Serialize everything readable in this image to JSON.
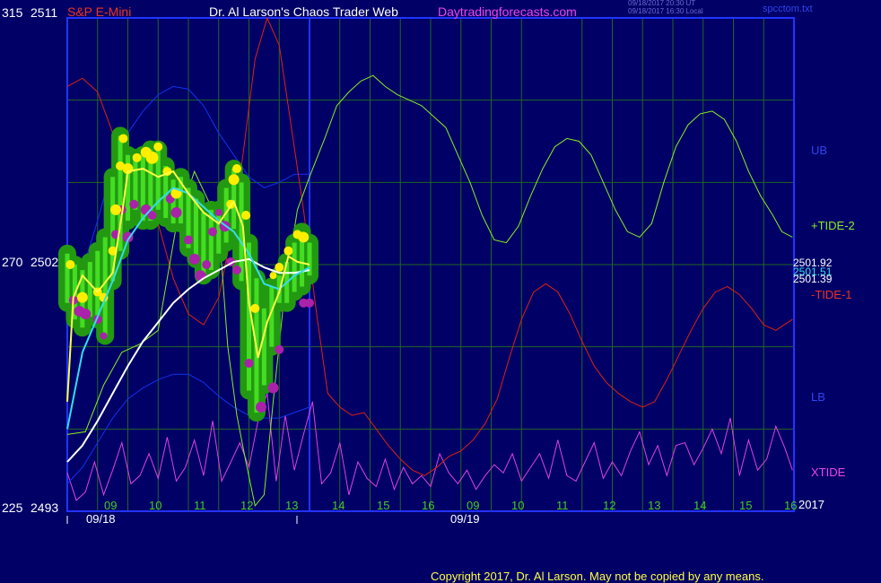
{
  "header": {
    "symbol": "S&P E-Mini",
    "title": "Dr. Al Larson's Chaos Trader Web",
    "site": "Daytradingforecasts.com",
    "timestamp_1": "09/18/2017 20:30 UT",
    "timestamp_2": "09/18/2017 16:30 Local",
    "file": "spcctom.txt"
  },
  "y_axis": {
    "top_left": "315",
    "top_right": "2511",
    "mid_left": "270",
    "mid_right": "2502",
    "bottom_left": "225",
    "bottom_right": "2493"
  },
  "x_axis": {
    "day1_ticks": [
      "09",
      "10",
      "11",
      "12",
      "13",
      "14",
      "15",
      "16"
    ],
    "day2_ticks": [
      "09",
      "10",
      "11",
      "12",
      "13",
      "14",
      "15",
      "16"
    ],
    "date1": "09/18",
    "date2": "09/19",
    "year": "2017"
  },
  "right_labels": {
    "ub": "UB",
    "tide2": "+TIDE-2",
    "price1": "2501.92",
    "price2": "2501.51",
    "price3": "2501.39",
    "tide1": "-TIDE-1",
    "lb": "LB",
    "xtide": "XTIDE"
  },
  "copyright": "Copyright 2017, Dr. Al Larson. May not be copied by any means.",
  "colors": {
    "background": "#000066",
    "frame": "#2233ff",
    "grid": "#226622",
    "price_bars": "#44dd22",
    "price_glow": "#229911",
    "yellow_line": "#ffff44",
    "cyan_line": "#33ddee",
    "white_line": "#ffffff",
    "tide2": "#88ee22",
    "tide1": "#dd2211",
    "bands": "#1133ee",
    "xtide": "#dd44dd",
    "dots_yellow": "#ffee00",
    "dots_magenta": "#aa22aa"
  },
  "chart_data": {
    "type": "line",
    "x_unit": "hour of session (day 1 = 09/18, hours 25+ = 09/19 forecast)",
    "ylim_price": [
      2493,
      2511
    ],
    "ylim_scale": [
      225,
      315
    ],
    "x_range": [
      8.0,
      32.0
    ],
    "grid": true,
    "series": [
      {
        "name": "+TIDE-2",
        "x": [
          8.0,
          8.6,
          9.2,
          9.8,
          10.4,
          11.0,
          11.6,
          12.2,
          12.8,
          13.1,
          13.3,
          13.6,
          13.9,
          14.2,
          14.5,
          14.8,
          15.2,
          15.6,
          16.0,
          16.5,
          16.9,
          17.3,
          17.7,
          18.1,
          18.5,
          18.9,
          19.3,
          19.7,
          20.1,
          20.5,
          20.9,
          21.3,
          21.7,
          22.1,
          22.5,
          22.9,
          23.3,
          23.7,
          24.1,
          24.5,
          24.9,
          25.3,
          25.7,
          26.1,
          26.5,
          26.9,
          27.3,
          27.7,
          28.1,
          28.5,
          28.9,
          29.3,
          29.7,
          30.1,
          30.5,
          30.9,
          31.3,
          31.6,
          31.95
        ],
        "y": [
          2495.8,
          2495.9,
          2497.6,
          2498.8,
          2499.1,
          2499.6,
          2503.4,
          2505.4,
          2504.0,
          2502.0,
          2499.0,
          2496.5,
          2494.8,
          2493.2,
          2493.6,
          2497.0,
          2501.2,
          2504.0,
          2505.2,
          2506.6,
          2507.8,
          2508.3,
          2508.7,
          2508.9,
          2508.5,
          2508.2,
          2508.0,
          2507.8,
          2507.4,
          2507.0,
          2506.0,
          2505.0,
          2503.8,
          2502.9,
          2502.8,
          2503.4,
          2504.5,
          2505.5,
          2506.3,
          2506.6,
          2506.5,
          2506.0,
          2505.0,
          2504.0,
          2503.2,
          2503.0,
          2503.5,
          2505.0,
          2506.3,
          2507.1,
          2507.5,
          2507.6,
          2507.3,
          2506.5,
          2505.4,
          2504.5,
          2503.8,
          2503.2,
          2503.0
        ]
      },
      {
        "name": "-TIDE-1",
        "x": [
          8.0,
          8.5,
          9.0,
          9.5,
          10.0,
          10.5,
          11.0,
          11.5,
          12.0,
          12.5,
          13.0,
          13.4,
          13.8,
          14.2,
          14.6,
          15.0,
          15.4,
          15.8,
          16.2,
          16.6,
          17.0,
          17.4,
          17.8,
          18.2,
          18.6,
          19.0,
          19.4,
          19.8,
          20.2,
          20.6,
          21.0,
          21.4,
          21.8,
          22.2,
          22.6,
          23.0,
          23.4,
          23.8,
          24.2,
          24.6,
          25.0,
          25.4,
          25.8,
          26.2,
          26.6,
          27.0,
          27.4,
          27.8,
          28.2,
          28.6,
          29.0,
          29.4,
          29.8,
          30.2,
          30.6,
          31.0,
          31.4,
          31.95
        ],
        "y": [
          2508.5,
          2508.8,
          2508.3,
          2506.8,
          2506.0,
          2505.2,
          2503.5,
          2501.5,
          2500.2,
          2499.8,
          2500.8,
          2503.0,
          2506.0,
          2509.5,
          2511.0,
          2510.0,
          2507.0,
          2504.0,
          2500.5,
          2497.3,
          2496.8,
          2496.5,
          2496.6,
          2496.0,
          2495.4,
          2494.9,
          2494.5,
          2494.3,
          2494.6,
          2495.0,
          2495.2,
          2495.6,
          2496.2,
          2497.1,
          2498.6,
          2500.0,
          2501.0,
          2501.3,
          2501.0,
          2500.2,
          2499.2,
          2498.3,
          2497.7,
          2497.3,
          2497.0,
          2496.8,
          2497.0,
          2497.8,
          2498.7,
          2499.6,
          2500.4,
          2501.0,
          2501.2,
          2500.9,
          2500.4,
          2499.8,
          2499.6,
          2500.0
        ]
      },
      {
        "name": "UB",
        "x": [
          8.0,
          8.5,
          9.0,
          9.5,
          10.0,
          10.5,
          11.0,
          11.5,
          12.0,
          12.5,
          13.0,
          13.5,
          14.0,
          14.5,
          15.0,
          15.5,
          16.0
        ],
        "y": [
          2500.5,
          2501.8,
          2503.6,
          2505.6,
          2506.8,
          2507.6,
          2508.2,
          2508.5,
          2508.4,
          2507.8,
          2506.8,
          2506.0,
          2505.2,
          2504.8,
          2505.0,
          2505.3,
          2505.3
        ]
      },
      {
        "name": "LB",
        "x": [
          8.0,
          8.5,
          9.0,
          9.5,
          10.0,
          10.5,
          11.0,
          11.5,
          12.0,
          12.5,
          13.0,
          13.5,
          14.0,
          14.5,
          15.0,
          15.5,
          16.0
        ],
        "y": [
          2494.0,
          2494.6,
          2495.5,
          2496.4,
          2497.1,
          2497.5,
          2497.8,
          2498.0,
          2498.0,
          2497.7,
          2497.2,
          2496.8,
          2496.5,
          2496.4,
          2496.4,
          2496.6,
          2496.8
        ]
      },
      {
        "name": "yellow_ma",
        "x": [
          8.0,
          8.2,
          8.5,
          9.0,
          9.5,
          9.8,
          10.0,
          10.5,
          11.0,
          11.5,
          12.0,
          12.5,
          13.0,
          13.5,
          13.8,
          14.0,
          14.3,
          14.6,
          15.0,
          15.3,
          15.6,
          16.0
        ],
        "y": [
          2497.0,
          2500.8,
          2501.6,
          2501.0,
          2501.7,
          2503.8,
          2505.4,
          2505.5,
          2505.2,
          2505.4,
          2504.6,
          2503.9,
          2503.5,
          2504.3,
          2503.4,
          2500.6,
          2498.6,
          2499.9,
          2501.0,
          2502.3,
          2502.1,
          2502.0
        ]
      },
      {
        "name": "cyan_ma",
        "x": [
          8.0,
          8.5,
          9.0,
          9.5,
          10.0,
          10.5,
          11.0,
          11.5,
          12.0,
          12.5,
          13.0,
          13.5,
          14.0,
          14.5,
          15.0,
          15.5,
          16.0
        ],
        "y": [
          2496.0,
          2498.8,
          2500.1,
          2501.4,
          2502.9,
          2503.7,
          2504.3,
          2504.8,
          2504.6,
          2504.1,
          2503.6,
          2503.2,
          2502.4,
          2501.3,
          2501.1,
          2501.6,
          2501.9
        ]
      },
      {
        "name": "white_ma",
        "x": [
          8.0,
          8.5,
          9.0,
          9.5,
          10.0,
          10.5,
          11.0,
          11.5,
          12.0,
          12.5,
          13.0,
          13.5,
          14.0,
          14.5,
          15.0,
          15.5,
          16.0
        ],
        "y": [
          2494.8,
          2495.4,
          2496.3,
          2497.3,
          2498.3,
          2499.2,
          2499.9,
          2500.6,
          2501.1,
          2501.5,
          2501.8,
          2502.1,
          2502.2,
          2501.9,
          2501.7,
          2501.7,
          2501.8
        ]
      },
      {
        "name": "XTIDE",
        "x": [
          8.0,
          8.3,
          8.6,
          8.9,
          9.2,
          9.5,
          9.8,
          10.1,
          10.4,
          10.7,
          11.0,
          11.3,
          11.6,
          11.9,
          12.2,
          12.5,
          12.8,
          13.1,
          13.4,
          13.7,
          14.0,
          14.3,
          14.6,
          14.9,
          15.2,
          15.5,
          15.8,
          16.1,
          16.4,
          16.7,
          17.0,
          17.3,
          17.6,
          17.9,
          18.2,
          18.5,
          18.8,
          19.1,
          19.4,
          19.7,
          20.0,
          20.3,
          20.6,
          20.9,
          21.2,
          21.5,
          21.8,
          22.1,
          22.4,
          22.7,
          23.0,
          23.3,
          23.6,
          23.9,
          24.2,
          24.5,
          24.8,
          25.1,
          25.4,
          25.7,
          26.0,
          26.3,
          26.6,
          26.9,
          27.2,
          27.5,
          27.8,
          28.1,
          28.4,
          28.7,
          29.0,
          29.3,
          29.6,
          29.9,
          30.2,
          30.5,
          30.8,
          31.1,
          31.4,
          31.7,
          31.95
        ],
        "y": [
          2494.4,
          2493.4,
          2493.7,
          2494.8,
          2493.6,
          2494.5,
          2495.5,
          2494.0,
          2494.3,
          2495.1,
          2494.2,
          2495.7,
          2494.1,
          2494.6,
          2495.6,
          2494.3,
          2496.3,
          2494.1,
          2494.8,
          2495.5,
          2494.6,
          2496.3,
          2497.3,
          2494.1,
          2496.5,
          2494.5,
          2495.8,
          2497.0,
          2494.0,
          2494.4,
          2495.5,
          2493.6,
          2494.8,
          2494.2,
          2493.9,
          2494.9,
          2493.8,
          2494.6,
          2494.0,
          2494.3,
          2493.9,
          2495.1,
          2494.4,
          2494.0,
          2494.5,
          2493.8,
          2494.3,
          2494.7,
          2494.4,
          2495.1,
          2494.1,
          2494.6,
          2495.1,
          2494.2,
          2495.6,
          2494.3,
          2494.1,
          2494.8,
          2495.5,
          2494.2,
          2494.8,
          2494.3,
          2495.2,
          2495.9,
          2494.7,
          2495.4,
          2494.3,
          2495.4,
          2495.5,
          2494.7,
          2495.3,
          2496.0,
          2495.1,
          2496.4,
          2494.3,
          2495.6,
          2494.5,
          2494.9,
          2496.1,
          2495.3,
          2494.5
        ]
      }
    ],
    "price_bars": {
      "x": [
        8.0,
        8.25,
        8.5,
        8.75,
        9.0,
        9.25,
        9.5,
        9.75,
        10.0,
        10.25,
        10.5,
        10.75,
        11.0,
        11.25,
        11.5,
        11.75,
        12.0,
        12.25,
        12.5,
        12.75,
        13.0,
        13.25,
        13.5,
        13.75,
        14.0,
        14.25,
        14.5,
        14.75,
        15.0,
        15.25,
        15.5,
        15.75,
        16.0
      ],
      "high": [
        2502.4,
        2502.0,
        2501.8,
        2502.1,
        2502.5,
        2503.0,
        2505.2,
        2506.7,
        2506.0,
        2505.9,
        2506.0,
        2506.2,
        2506.2,
        2505.6,
        2505.1,
        2505.2,
        2504.8,
        2504.4,
        2503.9,
        2504.0,
        2504.0,
        2504.8,
        2505.5,
        2505.0,
        2502.8,
        2501.5,
        2500.4,
        2501.2,
        2501.6,
        2502.1,
        2502.8,
        2503.2,
        2502.8
      ],
      "low": [
        2500.6,
        2500.0,
        2499.7,
        2500.1,
        2500.0,
        2499.4,
        2501.4,
        2502.5,
        2503.6,
        2504.0,
        2503.6,
        2503.6,
        2504.0,
        2503.7,
        2503.5,
        2503.5,
        2502.6,
        2502.2,
        2501.6,
        2501.8,
        2502.4,
        2502.8,
        2503.3,
        2501.4,
        2497.4,
        2496.6,
        2497.6,
        2499.0,
        2500.6,
        2500.6,
        2501.0,
        2501.2,
        2501.6
      ]
    },
    "yellow_dots": {
      "x": [
        8.1,
        8.5,
        9.0,
        9.2,
        9.5,
        9.6,
        9.75,
        9.85,
        10.0,
        10.3,
        10.6,
        10.8,
        11.0,
        11.3,
        11.6,
        13.4,
        13.5,
        13.6,
        13.9,
        14.2,
        14.8,
        15.0,
        15.3,
        15.6,
        15.8
      ],
      "y": [
        2502.0,
        2500.8,
        2501.0,
        2500.8,
        2502.5,
        2504.0,
        2505.6,
        2506.6,
        2505.5,
        2505.9,
        2506.1,
        2505.9,
        2506.3,
        2505.4,
        2504.6,
        2504.2,
        2505.1,
        2505.5,
        2503.8,
        2500.4,
        2501.6,
        2501.9,
        2502.5,
        2503.1,
        2503.0
      ],
      "r": [
        5,
        6,
        5,
        5,
        5,
        6,
        5,
        5,
        6,
        5,
        6,
        7,
        5,
        5,
        6,
        5,
        6,
        5,
        5,
        5,
        4,
        5,
        5,
        5,
        6
      ]
    },
    "magenta_dots": {
      "x": [
        8.2,
        8.4,
        8.6,
        9.0,
        9.2,
        9.6,
        9.8,
        10.0,
        10.2,
        10.6,
        10.8,
        11.4,
        11.6,
        12.0,
        12.2,
        12.4,
        12.6,
        12.8,
        13.0,
        13.2,
        13.4,
        13.6,
        14.0,
        14.4,
        14.8,
        15.0,
        15.8,
        16.0
      ],
      "y": [
        2500.7,
        2500.3,
        2500.2,
        2500.0,
        2499.4,
        2503.1,
        2504.0,
        2503.0,
        2504.2,
        2504.0,
        2503.8,
        2504.4,
        2503.9,
        2502.9,
        2502.2,
        2501.6,
        2502.0,
        2503.2,
        2503.9,
        2503.4,
        2502.1,
        2501.8,
        2498.4,
        2496.8,
        2497.5,
        2498.9,
        2500.6,
        2500.6
      ],
      "r": [
        5,
        6,
        6,
        5,
        4,
        5,
        5,
        6,
        5,
        6,
        5,
        5,
        6,
        5,
        6,
        6,
        5,
        5,
        4,
        6,
        5,
        5,
        5,
        6,
        6,
        5,
        5,
        5
      ]
    }
  }
}
